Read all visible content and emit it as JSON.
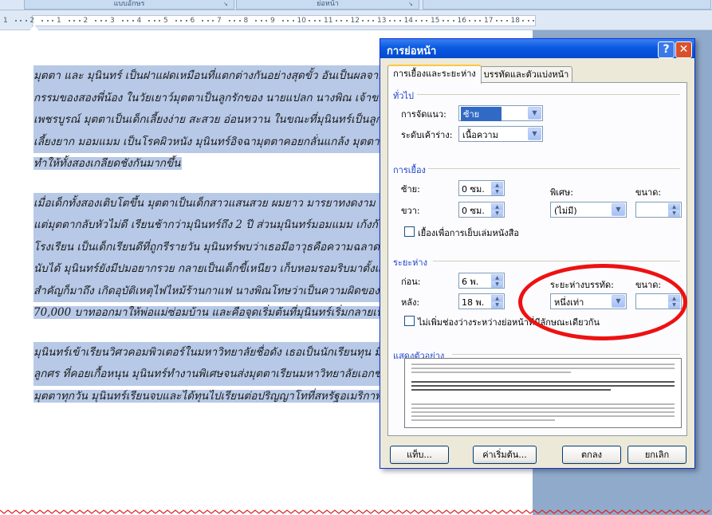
{
  "ribbon": {
    "groups": [
      "แบบอักษร",
      "ย่อหน้า"
    ]
  },
  "ruler": {
    "labels": [
      "1",
      "2",
      "1",
      "2",
      "3",
      "4",
      "5",
      "6",
      "7",
      "8",
      "9",
      "10",
      "11",
      "12",
      "13",
      "14",
      "15",
      "16",
      "17",
      "18"
    ]
  },
  "document": {
    "paragraphs": [
      {
        "lines": [
          "มุตตา และ มุนินทร์ เป็นฝาแฝดเหมือนที่แตกต่างกันอย่างสุดขั้ว อันเป็นผลจากกา",
          "กรรมของสองพี่น้อง ในวัยเยาว์มุตตาเป็นลูกรักของ นายแปลก นางพิณ เจ้าของร้",
          "เพชรบูรณ์ มุตตาเป็นเด็กเลี้ยงง่าย สะสวย อ่อนหวาน ในขณะที่มุนินทร์เป็นลูกชัง",
          "เลี้ยงยาก มอมแมม เป็นโรคผิวหนัง มุนินทร์อิจฉามุตตาคอยกลั่นแกล้ง มุตตาเอง",
          "ทำให้ทั้งสองเกลียดชังกันมากขึ้น"
        ]
      },
      {
        "lines": [
          "เมื่อเด็กทั้งสองเติบโตขึ้น มุตตาเป็นเด็กสาวแสนสวย ผมยาว มารยาทงดงาม เก่ง",
          "แต่มุตตากลับหัวไม่ดี เรียนช้ากว่ามุนินทร์ถึง 2 ปี ส่วนมุนินทร์มอมแมม เก้งก้าง",
          "โรงเรียน เป็นเด็กเรียนดีที่ถูกรีรายวัน มุนินทร์พบว่าเธอมีอาวุธคือความฉลาด และ",
          "นับได้ มุนินทร์ยังมีปมอยากรวย กลายเป็นเด็กขี้เหนียว เก็บหอมรอมริบมาตั้งแต่เด็",
          "สำคัญก็มาถึง เกิดอุบัติเหตุไฟไหม้ร้านกาแฟ นางพิณโทษว่าเป็นความผิดของมุตตา",
          "70,000 บาทออกมาให้พ่อแม่ซ่อมบ้าน และคือจุดเริ่มต้นที่มุนินทร์เริ่มกลายเป็นลูก"
        ]
      },
      {
        "lines": [
          "มุนินทร์เข้าเรียนวิศวคอมพิวเตอร์ในมหาวิทยาลัยชื่อดัง เธอเป็นนักเรียนทุน มีเพื่อน",
          "ลูกศร ที่คอยเกื้อหนุน มุนินทร์ทำงานพิเศษจนส่งมุตตาเรียนมหาวิทยาลัยเอกชน และคอยดูแล",
          "มุตตาทุกวัน มุนินทร์เรียนจบและได้ทุนไปเรียนต่อปริญญาโทที่สหรัฐอเมริกาพร้อมกับลูกศร ลูกศรเป็น"
        ]
      }
    ]
  },
  "dialog": {
    "title": "การย่อหน้า",
    "help": "?",
    "close": "✕",
    "tabs": [
      "การเยื้องและระยะห่าง",
      "บรรทัดและตัวแบ่งหน้า"
    ],
    "general": {
      "heading": "ทั่วไป",
      "alignment_label": "การจัดแนว:",
      "alignment_value": "ซ้าย",
      "outline_label": "ระดับเค้าร่าง:",
      "outline_value": "เนื้อความ"
    },
    "indentation": {
      "heading": "การเยื้อง",
      "left_label": "ซ้าย:",
      "left_value": "0 ซม.",
      "right_label": "ขวา:",
      "right_value": "0 ซม.",
      "special_label": "พิเศษ:",
      "special_value": "(ไม่มี)",
      "by_label": "ขนาด:",
      "by_value": "",
      "mirror_label": "เยื้องเพื่อการเย็บเล่มหนังสือ"
    },
    "spacing": {
      "heading": "ระยะห่าง",
      "before_label": "ก่อน:",
      "before_value": "6 พ.",
      "after_label": "หลัง:",
      "after_value": "18 พ.",
      "line_label": "ระยะห่างบรรทัด:",
      "line_value": "หนึ่งเท่า",
      "at_label": "ขนาด:",
      "at_value": "",
      "dont_add_label": "ไม่เพิ่มช่องว่างระหว่างย่อหน้าที่มีลักษณะเดียวกัน"
    },
    "preview": {
      "heading": "แสดงตัวอย่าง"
    },
    "buttons": {
      "tabs": "แท็บ...",
      "default": "ค่าเริ่มต้น...",
      "ok": "ตกลง",
      "cancel": "ยกเลิก"
    }
  },
  "colors": {
    "selection": "#b7c9e7",
    "titlebar": "#0a59e0",
    "annotation": "#ee1111"
  }
}
